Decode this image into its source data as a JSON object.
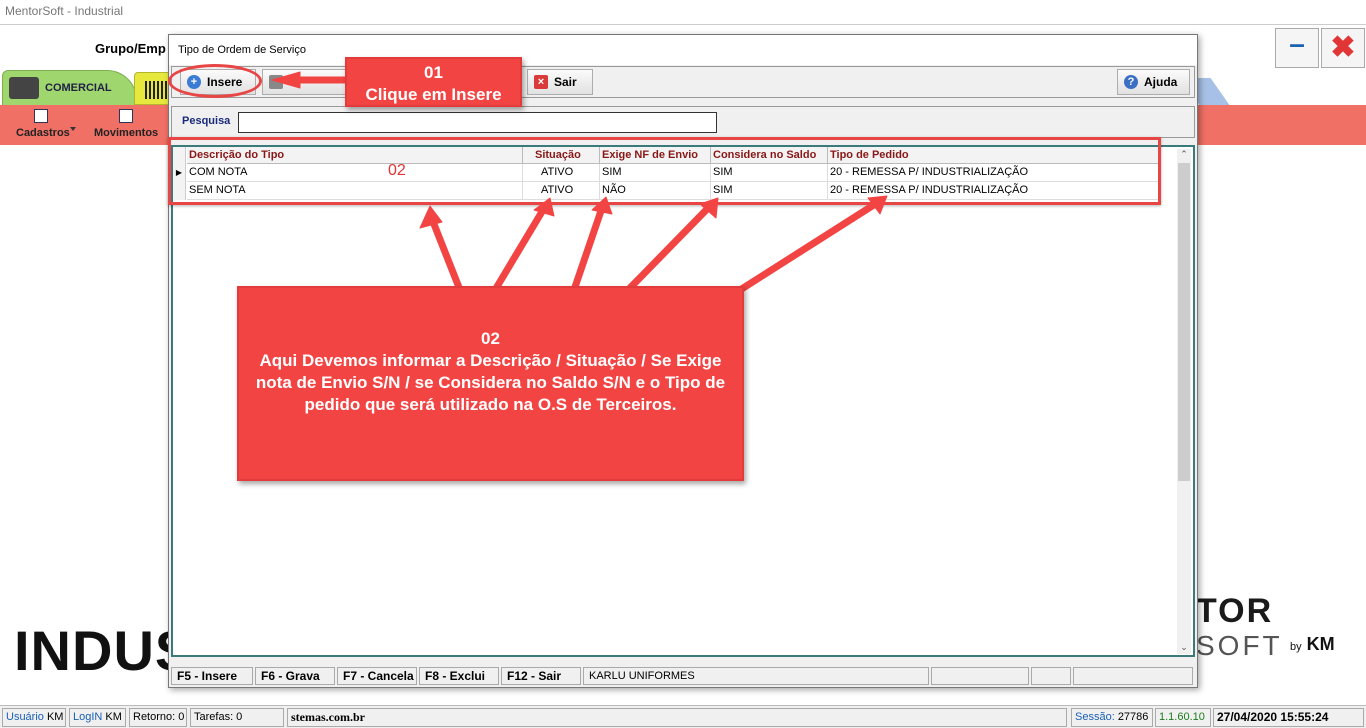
{
  "app": {
    "title": "MentorSoft - Industrial",
    "group_label": "Grupo/Emp",
    "minimize": "–",
    "close": "✖"
  },
  "tabs": {
    "comercial": "COMERCIAL"
  },
  "ribbon": {
    "cadastros": "Cadastros",
    "movimentos": "Movimentos"
  },
  "background": {
    "industrial_text": "INDUS",
    "logo_line1": "TOR",
    "logo_line2": "SOFT",
    "logo_by": "by",
    "logo_km": "KM"
  },
  "dialog": {
    "title": "Tipo de Ordem de Serviço",
    "toolbar": {
      "insere": "Insere",
      "sair": "Sair",
      "ajuda": "Ajuda"
    },
    "search": {
      "label": "Pesquisa",
      "value": ""
    },
    "grid": {
      "columns": [
        "Descrição do Tipo",
        "Situação",
        "Exige NF de Envio",
        "Considera no Saldo",
        "Tipo de Pedido"
      ],
      "rows": [
        [
          "COM NOTA",
          "ATIVO",
          "SIM",
          "SIM",
          "20 - REMESSA P/ INDUSTRIALIZAÇÃO"
        ],
        [
          "SEM NOTA",
          "ATIVO",
          "NÃO",
          "SIM",
          "20 - REMESSA P/ INDUSTRIALIZAÇÃO"
        ]
      ]
    },
    "fkeys": {
      "f5": "F5 - Insere",
      "f6": "F6 - Grava",
      "f7": "F7 - Cancela",
      "f8": "F8 - Exclui",
      "f12": "F12 - Sair",
      "company": "KARLU UNIFORMES"
    }
  },
  "annotations": {
    "step1_num": "01",
    "step1_text": "Clique em Insere",
    "step2_small": "02",
    "step2_num": "02",
    "step2_text": "Aqui Devemos informar a Descrição / Situação / Se Exige nota de Envio S/N / se Considera no Saldo S/N  e o Tipo de pedido que será utilizado na O.S de Terceiros."
  },
  "statusbar": {
    "usuario_label": "Usuário",
    "usuario_value": "KM",
    "login_label": "LogIN",
    "login_value": "KM",
    "retorno": "Retorno: 0",
    "tarefas": "Tarefas: 0",
    "site": "stemas.com.br",
    "sessao_label": "Sessão:",
    "sessao_value": "27786",
    "version": "1.1.60.10",
    "datetime": "27/04/2020 15:55:24"
  },
  "colors": {
    "ribbon": "#f07065",
    "annotation_red": "#f34444",
    "header_text": "#8a1717"
  }
}
